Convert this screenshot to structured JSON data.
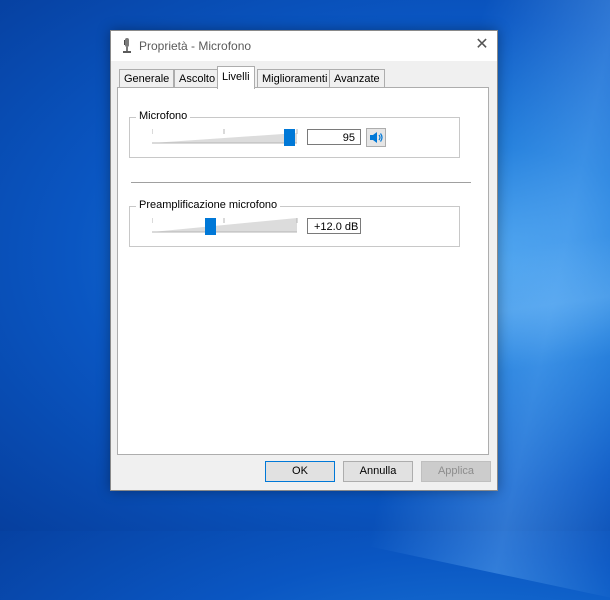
{
  "window": {
    "title": "Proprietà - Microfono",
    "close_glyph": "✕"
  },
  "tabs": [
    {
      "label": "Generale"
    },
    {
      "label": "Ascolto"
    },
    {
      "label": "Livelli",
      "active": true
    },
    {
      "label": "Miglioramenti"
    },
    {
      "label": "Avanzate"
    }
  ],
  "levels": {
    "microphone": {
      "label": "Microfono",
      "value": "95",
      "slider_fraction": 0.95,
      "mute_icon": "speaker-icon"
    },
    "boost": {
      "label": "Preamplificazione microfono",
      "value": "+12.0 dB",
      "slider_fraction": 0.4
    }
  },
  "footer": {
    "ok": "OK",
    "cancel": "Annulla",
    "apply": "Applica"
  },
  "colors": {
    "accent": "#0078d7"
  }
}
